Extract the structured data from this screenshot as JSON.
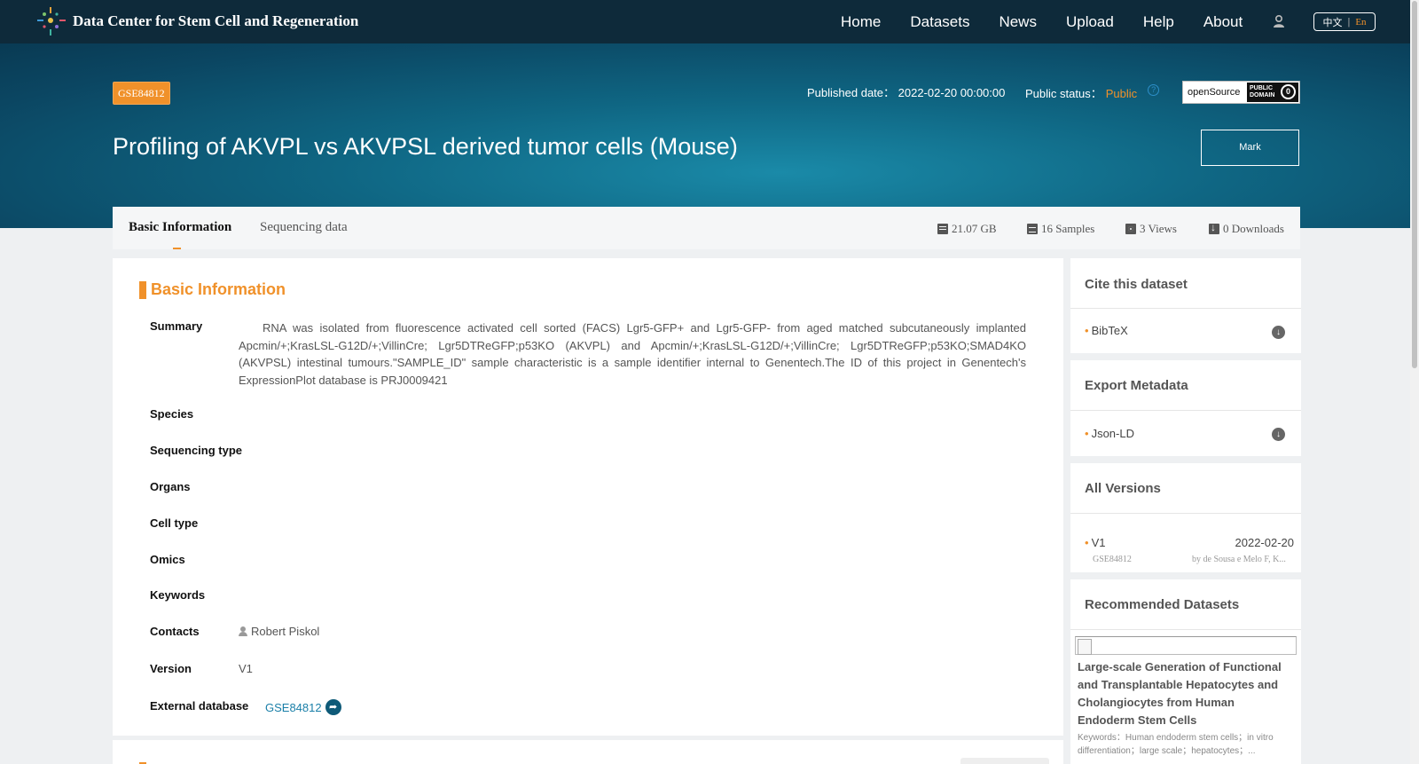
{
  "nav": {
    "brand": "Data Center for Stem Cell and Regeneration",
    "items": [
      "Home",
      "Datasets",
      "News",
      "Upload",
      "Help",
      "About"
    ],
    "lang_zh": "中文",
    "lang_sep": "|",
    "lang_en": "En"
  },
  "hero": {
    "accession": "GSE84812",
    "published_label": "Published date：",
    "published_value": "2022-02-20 00:00:00",
    "status_label": "Public status：",
    "status_value": "Public",
    "help_glyph": "?",
    "license_label": "openSource",
    "license_badge_line1": "PUBLIC",
    "license_badge_line2": "DOMAIN",
    "title": "Profiling of AKVPL vs AKVPSL derived tumor cells (Mouse)",
    "mark_label": "Mark"
  },
  "tabs": {
    "basic": "Basic Information",
    "sequencing": "Sequencing data"
  },
  "stats": {
    "size": "21.07 GB",
    "samples": "16 Samples",
    "views": "3 Views",
    "downloads": "0 Downloads"
  },
  "basic": {
    "section_title": "Basic Information",
    "labels": {
      "summary": "Summary",
      "species": "Species",
      "sequencing_type": "Sequencing type",
      "organs": "Organs",
      "cell_type": "Cell type",
      "omics": "Omics",
      "keywords": "Keywords",
      "contacts": "Contacts",
      "version": "Version",
      "external_database": "External database"
    },
    "summary": "RNA was isolated from fluorescence activated cell sorted (FACS) Lgr5-GFP+ and Lgr5-GFP- from aged matched subcutaneously implanted Apcmin/+;KrasLSL-G12D/+;VillinCre; Lgr5DTReGFP;p53KO (AKVPL) and Apcmin/+;KrasLSL-G12D/+;VillinCre; Lgr5DTReGFP;p53KO;SMAD4KO (AKVPSL) intestinal tumours.\"SAMPLE_ID\" sample characteristic is a sample identifier internal to Genentech.The ID of this project in Genentech's ExpressionPlot database is PRJ0009421",
    "contact": "Robert Piskol",
    "version": "V1",
    "external_id": "GSE84812",
    "share_glyph": "➦"
  },
  "sidebar": {
    "cite_title": "Cite this dataset",
    "cite_item": "BibTeX",
    "export_title": "Export Metadata",
    "export_item": "Json-LD",
    "download_glyph": "↓",
    "bullet": "•",
    "versions_title": "All Versions",
    "version_name": "V1",
    "version_date": "2022-02-20",
    "version_accession": "GSE84812",
    "version_authors": "by de Sousa e Melo F, K...",
    "recommended_title": "Recommended Datasets",
    "rec_dataset_title": "Large-scale Generation of Functional and Transplantable Hepatocytes and Cholangiocytes from Human Endoderm Stem Cells",
    "rec_dataset_keywords": "Keywords：Human endoderm stem cells；in vitro differentiation；large scale；hepatocytes；..."
  },
  "colors": {
    "accent": "#f0912a",
    "nav_bg": "#0e2a3a",
    "hero_bg": "#0f6683",
    "link": "#1a7fa8"
  }
}
